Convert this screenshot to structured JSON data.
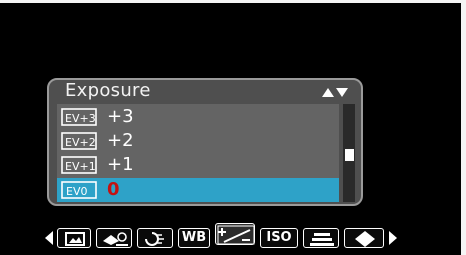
{
  "menu": {
    "title": "Exposure",
    "options": [
      {
        "icon": "ev-plus-3-icon",
        "badge": "EV+3",
        "value": "+3",
        "selected": false
      },
      {
        "icon": "ev-plus-2-icon",
        "badge": "EV+2",
        "value": "+2",
        "selected": false
      },
      {
        "icon": "ev-plus-1-icon",
        "badge": "EV+1",
        "value": "+1",
        "selected": false
      },
      {
        "icon": "ev-0-icon",
        "badge": "EV0",
        "value": "0",
        "selected": true
      }
    ]
  },
  "toolbar": {
    "items": [
      {
        "name": "scene-mode-icon"
      },
      {
        "name": "self-timer-icon"
      },
      {
        "name": "stabilizer-icon"
      },
      {
        "label": "WB"
      },
      {
        "name": "exposure-icon",
        "active": true
      },
      {
        "label": "ISO"
      },
      {
        "name": "metering-icon"
      },
      {
        "name": "sharpness-icon"
      }
    ]
  },
  "colors": {
    "background": "#000000",
    "panel": "#4f4f4f",
    "list": "#646464",
    "highlight": "#2ea2c8",
    "selected_value": "#c41212"
  }
}
